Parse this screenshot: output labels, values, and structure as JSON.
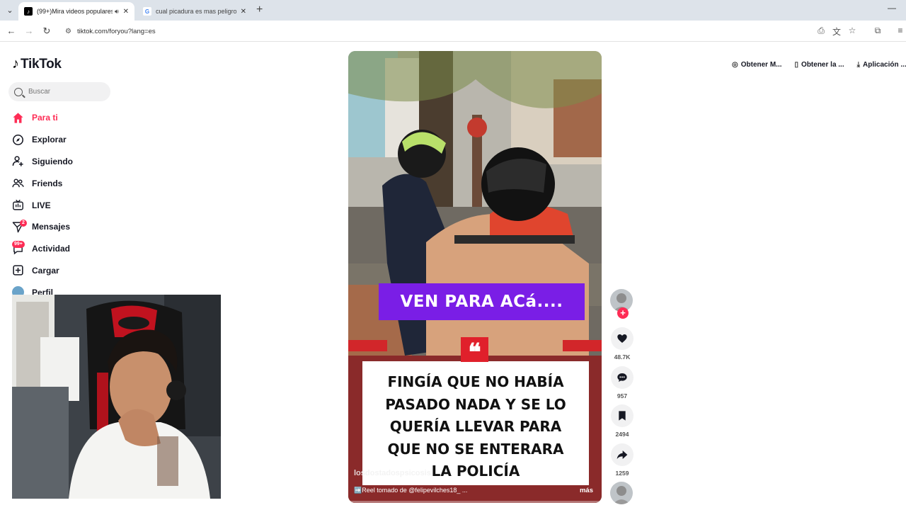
{
  "browser": {
    "tabs": [
      {
        "title": "(99+)Mira videos populares",
        "active": true
      },
      {
        "title": "cual picadura es mas peligrosa",
        "active": false
      }
    ],
    "url": "tiktok.com/foryou?lang=es"
  },
  "sidebar": {
    "logo": "TikTok",
    "search_placeholder": "Buscar",
    "items": [
      {
        "label": "Para ti",
        "icon": "home-icon",
        "active": true
      },
      {
        "label": "Explorar",
        "icon": "compass-icon"
      },
      {
        "label": "Siguiendo",
        "icon": "following-icon"
      },
      {
        "label": "Friends",
        "icon": "friends-icon"
      },
      {
        "label": "LIVE",
        "icon": "live-icon"
      },
      {
        "label": "Mensajes",
        "icon": "messages-icon",
        "badge": "2"
      },
      {
        "label": "Actividad",
        "icon": "activity-icon",
        "badge": "99+"
      },
      {
        "label": "Cargar",
        "icon": "upload-icon"
      }
    ],
    "perfil": "Perfil"
  },
  "top_links": [
    {
      "label": "Obtener M...",
      "icon": "coin-icon"
    },
    {
      "label": "Obtener la ...",
      "icon": "phone-icon"
    },
    {
      "label": "Aplicación ...",
      "icon": "download-icon"
    }
  ],
  "video": {
    "banner": "VEN PARA ACá....",
    "quote_mark": "❝",
    "card_lines": [
      "FINGÍA QUE NO HABÍA",
      "PASADO NADA Y SE LO",
      "QUERÍA LLEVAR PARA",
      "QUE NO SE ENTERARA",
      "LA POLICÍA"
    ],
    "author": "losdostadospsicosis",
    "caption": "➡️Reel tomado de @felipevilches18_ ...",
    "more": "más"
  },
  "actions": {
    "likes": "48.7K",
    "comments": "957",
    "saves": "2494",
    "shares": "1259"
  },
  "colors": {
    "accent": "#fe2c55",
    "banner_purple": "#7a1ee6",
    "quote_red": "#e0202b"
  }
}
